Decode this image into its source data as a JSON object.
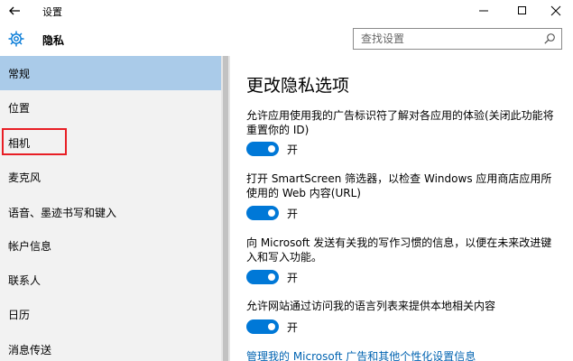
{
  "window": {
    "title": "设置"
  },
  "header": {
    "title": "隐私"
  },
  "search": {
    "placeholder": "查找设置"
  },
  "sidebar": {
    "items": [
      {
        "label": "常规"
      },
      {
        "label": "位置"
      },
      {
        "label": "相机"
      },
      {
        "label": "麦克风"
      },
      {
        "label": "语音、墨迹书写和键入"
      },
      {
        "label": "帐户信息"
      },
      {
        "label": "联系人"
      },
      {
        "label": "日历"
      },
      {
        "label": "消息传送"
      }
    ]
  },
  "main": {
    "title": "更改隐私选项",
    "options": [
      {
        "text": "允许应用使用我的广告标识符了解对各应用的体验(关闭此功能将重置你的 ID)",
        "state": "开"
      },
      {
        "text": "打开 SmartScreen 筛选器，以检查 Windows 应用商店应用所使用的 Web 内容(URL)",
        "state": "开"
      },
      {
        "text": "向 Microsoft 发送有关我的写作习惯的信息，以便在未来改进键入和写入功能。",
        "state": "开"
      },
      {
        "text": "允许网站通过访问我的语言列表来提供本地相关内容",
        "state": "开"
      }
    ],
    "link": "管理我的 Microsoft 广告和其他个性化设置信息"
  },
  "colors": {
    "accent": "#0078d7",
    "active_nav": "#aacbe9",
    "highlight": "#e81e25",
    "link": "#0063b1"
  }
}
